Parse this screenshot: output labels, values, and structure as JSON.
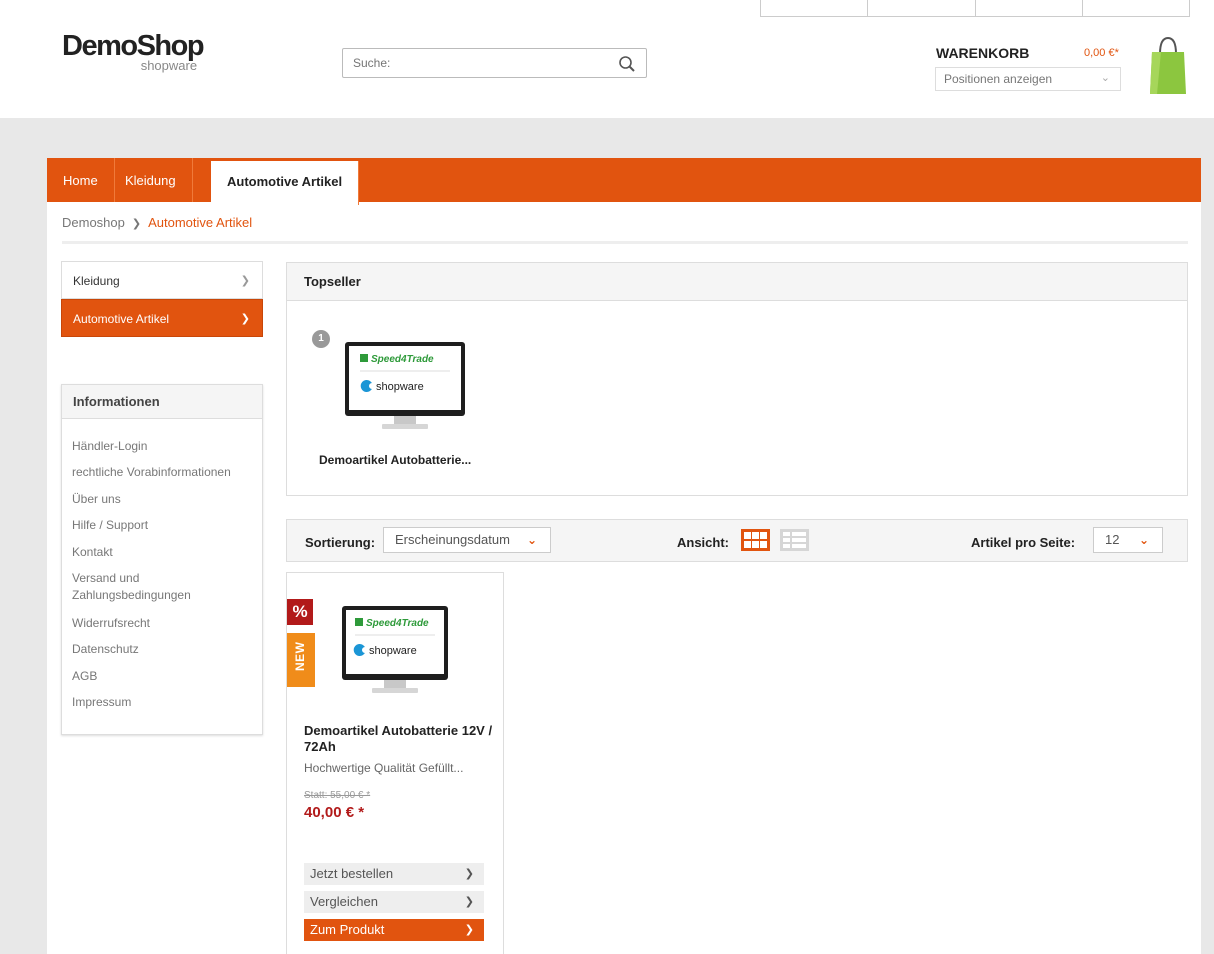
{
  "header": {
    "logo_main": "DemoShop",
    "logo_sub": "shopware",
    "search_placeholder": "Suche:",
    "cart_title": "WARENKORB",
    "cart_price": "0,00 €*",
    "cart_positions": "Positionen anzeigen"
  },
  "nav": {
    "items": [
      "Home",
      "Kleidung",
      "Automotive Artikel"
    ],
    "active": "Automotive Artikel"
  },
  "breadcrumb": [
    "Demoshop",
    "Automotive Artikel"
  ],
  "sidebar": {
    "categories": [
      {
        "label": "Kleidung"
      },
      {
        "label": "Automotive Artikel"
      }
    ],
    "info_title": "Informationen",
    "info_links": [
      "Händler-Login",
      "rechtliche Vorabinformationen",
      "Über uns",
      "Hilfe / Support",
      "Kontakt",
      "Versand und Zahlungsbedingungen",
      "Widerrufsrecht",
      "Datenschutz",
      "AGB",
      "Impressum"
    ]
  },
  "topseller": {
    "title": "Topseller",
    "rank": "1",
    "product_title": "Demoartikel Autobatterie..."
  },
  "toolbar": {
    "sort_label": "Sortierung:",
    "sort_value": "Erscheinungsdatum",
    "view_label": "Ansicht:",
    "per_page_label": "Artikel pro Seite:",
    "per_page_value": "12"
  },
  "product": {
    "badge_discount": "%",
    "badge_new": "NEW",
    "title": "Demoartikel Autobatterie 12V / 72Ah",
    "description": "Hochwertige Qualität Gefüllt...",
    "old_price": "Statt: 55,00 € *",
    "price": "40,00 € *",
    "buttons": [
      "Jetzt bestellen",
      "Vergleichen",
      "Zum Produkt"
    ]
  },
  "image_text": {
    "brand1": "Speed4Trade",
    "brand2": "shopware"
  },
  "colors": {
    "accent": "#e1540f",
    "price_red": "#b21a1a",
    "new_badge": "#f08c1a",
    "cart_green": "#8cc63f"
  }
}
